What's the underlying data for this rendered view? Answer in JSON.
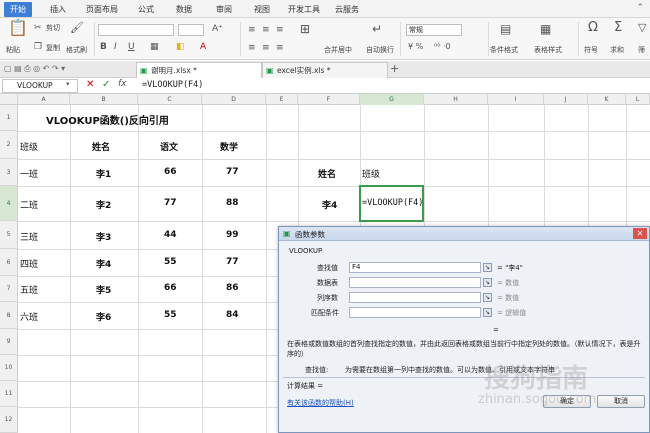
{
  "menu": {
    "tabs": [
      "开始",
      "插入",
      "页面布局",
      "公式",
      "数据",
      "审阅",
      "视图",
      "开发工具",
      "云服务"
    ],
    "active": "开始"
  },
  "ribbon": {
    "cut": "剪切",
    "paste": "粘贴",
    "copy": "复制",
    "format_painter": "格式刷",
    "merge_center": "合并居中",
    "wrap_text": "自动换行",
    "number_format": "常规",
    "conditional_format": "条件格式",
    "table_style": "表格样式",
    "symbol": "符号",
    "sum": "求和",
    "filter": "筛"
  },
  "file_tabs": [
    {
      "name": "谢明月.xlsx *",
      "active": true
    },
    {
      "name": "excel实例.xls *",
      "active": false
    }
  ],
  "formula_bar": {
    "name_box": "VLOOKUP",
    "fx": "fx",
    "content": "=VLOOKUP(F4)"
  },
  "columns": [
    "A",
    "B",
    "C",
    "D",
    "E",
    "F",
    "G",
    "H",
    "I",
    "J",
    "K",
    "L"
  ],
  "rows": [
    "1",
    "2",
    "3",
    "4",
    "5",
    "6",
    "7",
    "8",
    "9",
    "10",
    "11",
    "12"
  ],
  "sheet": {
    "title": "VLOOKUP函数()反向引用",
    "headers": {
      "class": "班级",
      "name": "姓名",
      "chinese": "语文",
      "math": "数学"
    },
    "data": [
      {
        "class": "一班",
        "name": "李1",
        "chinese": "66",
        "math": "77"
      },
      {
        "class": "二班",
        "name": "李2",
        "chinese": "77",
        "math": "88"
      },
      {
        "class": "三班",
        "name": "李3",
        "chinese": "44",
        "math": "99"
      },
      {
        "class": "四班",
        "name": "李4",
        "chinese": "55",
        "math": "77"
      },
      {
        "class": "五班",
        "name": "李5",
        "chinese": "66",
        "math": "86"
      },
      {
        "class": "六班",
        "name": "李6",
        "chinese": "55",
        "math": "84"
      }
    ],
    "lookup": {
      "name_label": "姓名",
      "class_label": "班级",
      "name_value": "李4",
      "formula": "=VLOOKUP(F4)"
    }
  },
  "dialog": {
    "title": "函数参数",
    "function_name": "VLOOKUP",
    "args": [
      {
        "label": "查找值",
        "value": "F4",
        "result": "= \"李4\""
      },
      {
        "label": "数据表",
        "value": "",
        "result": "= 数值"
      },
      {
        "label": "列序数",
        "value": "",
        "result": "= 数值"
      },
      {
        "label": "匹配条件",
        "value": "",
        "result": "= 逻辑值"
      }
    ],
    "equals": "=",
    "description": "在表格或数值数组的首列查找指定的数值，并由此返回表格或数组当前行中指定列处的数值。（默认情况下，表是升序的）",
    "arg_help_label": "查找值:",
    "arg_help": "为需要在数组第一列中查找的数值。可以为数值、引用或文本字符串",
    "calc_result_label": "计算结果 =",
    "help_link": "有关该函数的帮助(H)",
    "ok": "确定",
    "cancel": "取消"
  },
  "watermark": {
    "cn": "搜狗指南",
    "en": "zhinan.sogou.com"
  }
}
